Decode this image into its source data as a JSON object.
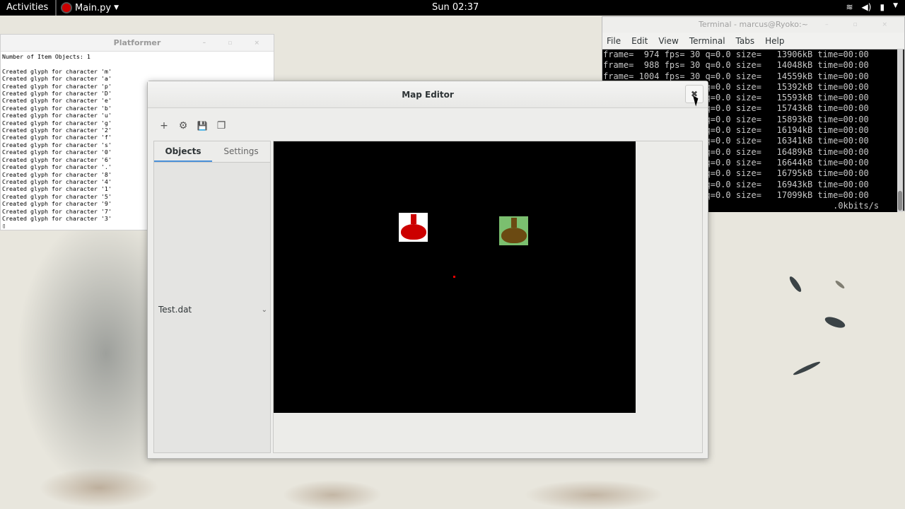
{
  "topbar": {
    "activities": "Activities",
    "app_name": "Main.py",
    "clock": "Sun 02:37"
  },
  "platformer": {
    "title": "Platformer",
    "log": "Number of Item Objects: 1\n\nCreated glyph for character 'm'\nCreated glyph for character 'a'\nCreated glyph for character 'p'\nCreated glyph for character 'D'\nCreated glyph for character 'e'\nCreated glyph for character 'b'\nCreated glyph for character 'u'\nCreated glyph for character 'g'\nCreated glyph for character '2'\nCreated glyph for character 'f'\nCreated glyph for character 's'\nCreated glyph for character '0'\nCreated glyph for character '6'\nCreated glyph for character '.'\nCreated glyph for character '8'\nCreated glyph for character '4'\nCreated glyph for character '1'\nCreated glyph for character '5'\nCreated glyph for character '9'\nCreated glyph for character '7'\nCreated glyph for character '3'\n▯"
  },
  "terminal": {
    "title": "Terminal - marcus@Ryoko:~",
    "menu": [
      "File",
      "Edit",
      "View",
      "Terminal",
      "Tabs",
      "Help"
    ],
    "output": "frame=  974 fps= 30 q=0.0 size=   13906kB time=00:00\nframe=  988 fps= 30 q=0.0 size=   14048kB time=00:00\nframe= 1004 fps= 30 q=0.0 size=   14559kB time=00:00\nframe= 1019 fps= 30 q=0.0 size=   15392kB time=00:00\nframe= 1034 fps= 30 q=0.0 size=   15593kB time=00:00\nframe= 1049 fps= 30 q=0.0 size=   15743kB time=00:00\nframe= 1064 fps= 30 q=0.0 size=   15893kB time=00:00\nframe= 1079 fps= 30 q=0.0 size=   16194kB time=00:00\nframe= 1094 fps= 30 q=0.0 size=   16341kB time=00:00\nframe= 1109 fps= 30 q=0.0 size=   16489kB time=00:00\nframe= 1124 fps= 30 q=0.0 size=   16644kB time=00:00\nframe= 1139 fps= 30 q=0.0 size=   16795kB time=00:00\nframe= 1154 fps= 30 q=0.0 size=   16943kB time=00:00\nframe= 1169 fps= 30 q=0.0 size=   17099kB time=00:00\n                                             .0kbits/s"
  },
  "editor": {
    "title": "Map Editor",
    "close": "✖",
    "toolbar": {
      "add": "+",
      "link": "⚙",
      "save": "💾",
      "copy": "❐"
    },
    "tabs": [
      "Objects",
      "Settings"
    ],
    "file_combo": "Test.dat",
    "chevron": "⌄"
  },
  "colors": {
    "canvas_bg": "#000000",
    "item1_bg": "#ffffff",
    "item1_potion": "#cc0000",
    "item2_bg": "#7bbf6f",
    "item2_potion": "#6b4a12",
    "marker": "#ee0000"
  }
}
